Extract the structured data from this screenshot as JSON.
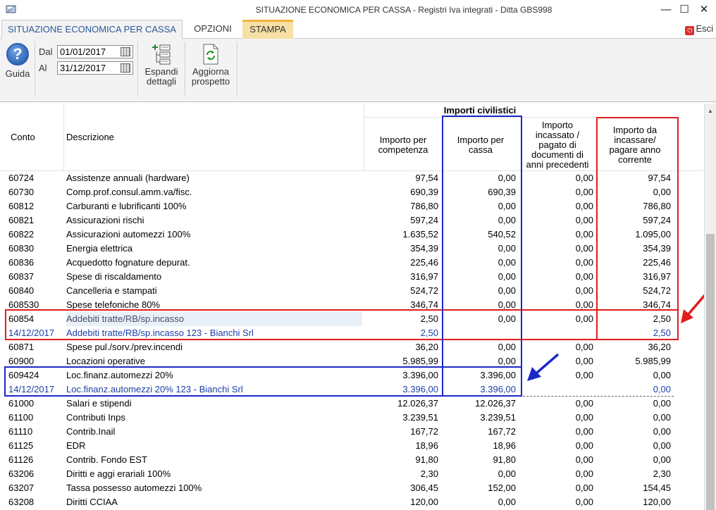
{
  "window": {
    "title": "SITUAZIONE ECONOMICA PER CASSA - Registri Iva integrati - Ditta GBS998",
    "minimize": "—",
    "maximize": "☐",
    "close": "✕"
  },
  "tabs": [
    {
      "label": "SITUAZIONE ECONOMICA PER CASSA"
    },
    {
      "label": "OPZIONI"
    },
    {
      "label": "STAMPA"
    }
  ],
  "esci_label": "Esci",
  "ribbon": {
    "guida_label": "Guida",
    "dal_label": "Dal",
    "dal_value": "01/01/2017",
    "al_label": "Al",
    "al_value": "31/12/2017",
    "espandi_line1": "Espandi",
    "espandi_line2": "dettagli",
    "aggiorna_line1": "Aggiorna",
    "aggiorna_line2": "prospetto"
  },
  "table": {
    "group_header": "Importi civilistici",
    "col_conto": "Conto",
    "col_desc": "Descrizione",
    "col_competenza": [
      "Importo per",
      "competenza"
    ],
    "col_cassa": [
      "Importo per",
      "cassa"
    ],
    "col_incassato": [
      "Importo",
      "incassato /",
      "pagato di",
      "documenti di",
      "anni precedenti"
    ],
    "col_incassare": [
      "Importo da",
      "incassare/",
      "pagare anno",
      "corrente"
    ],
    "rows": [
      {
        "conto": "60724",
        "desc": "Assistenze annuali (hardware)",
        "v1": "97,54",
        "v2": "0,00",
        "v3": "0,00",
        "v4": "97,54"
      },
      {
        "conto": "60730",
        "desc": "Comp.prof.consul.amm.va/fisc.",
        "v1": "690,39",
        "v2": "690,39",
        "v3": "0,00",
        "v4": "0,00"
      },
      {
        "conto": "60812",
        "desc": "Carburanti e lubrificanti 100%",
        "v1": "786,80",
        "v2": "0,00",
        "v3": "0,00",
        "v4": "786,80"
      },
      {
        "conto": "60821",
        "desc": "Assicurazioni rischi",
        "v1": "597,24",
        "v2": "0,00",
        "v3": "0,00",
        "v4": "597,24"
      },
      {
        "conto": "60822",
        "desc": "Assicurazioni automezzi 100%",
        "v1": "1.635,52",
        "v2": "540,52",
        "v3": "0,00",
        "v4": "1.095,00"
      },
      {
        "conto": "60830",
        "desc": "Energia elettrica",
        "v1": "354,39",
        "v2": "0,00",
        "v3": "0,00",
        "v4": "354,39"
      },
      {
        "conto": "60836",
        "desc": "Acquedotto fognature depurat.",
        "v1": "225,46",
        "v2": "0,00",
        "v3": "0,00",
        "v4": "225,46"
      },
      {
        "conto": "60837",
        "desc": "Spese di riscaldamento",
        "v1": "316,97",
        "v2": "0,00",
        "v3": "0,00",
        "v4": "316,97"
      },
      {
        "conto": "60840",
        "desc": "Cancelleria e stampati",
        "v1": "524,72",
        "v2": "0,00",
        "v3": "0,00",
        "v4": "524,72"
      },
      {
        "conto": "608530",
        "desc": "Spese telefoniche 80%",
        "v1": "346,74",
        "v2": "0,00",
        "v3": "0,00",
        "v4": "346,74"
      },
      {
        "conto": "60854",
        "desc": "Addebiti tratte/RB/sp.incasso",
        "v1": "2,50",
        "v2": "0,00",
        "v3": "0,00",
        "v4": "2,50",
        "style": "grey"
      },
      {
        "conto": "14/12/2017",
        "desc": "Addebiti tratte/RB/sp.incasso 123 -  Bianchi Srl",
        "v1": "2,50",
        "v2": "",
        "v3": "",
        "v4": "2,50",
        "style": "detail"
      },
      {
        "conto": "60871",
        "desc": "Spese pul./sorv./prev.incendi",
        "v1": "36,20",
        "v2": "0,00",
        "v3": "0,00",
        "v4": "36,20"
      },
      {
        "conto": "60900",
        "desc": "Locazioni operative",
        "v1": "5.985,99",
        "v2": "0,00",
        "v3": "0,00",
        "v4": "5.985,99"
      },
      {
        "conto": "609424",
        "desc": "Loc.finanz.automezzi 20%",
        "v1": "3.396,00",
        "v2": "3.396,00",
        "v3": "0,00",
        "v4": "0,00"
      },
      {
        "conto": "14/12/2017",
        "desc": "Loc.finanz.automezzi 20% 123 -  Bianchi Srl",
        "v1": "3.396,00",
        "v2": "3.396,00",
        "v3": "",
        "v4": "0,00",
        "style": "detail"
      },
      {
        "conto": "61000",
        "desc": "Salari e stipendi",
        "v1": "12.026,37",
        "v2": "12.026,37",
        "v3": "0,00",
        "v4": "0,00"
      },
      {
        "conto": "61100",
        "desc": "Contributi Inps",
        "v1": "3.239,51",
        "v2": "3.239,51",
        "v3": "0,00",
        "v4": "0,00"
      },
      {
        "conto": "61110",
        "desc": "Contrib.Inail",
        "v1": "167,72",
        "v2": "167,72",
        "v3": "0,00",
        "v4": "0,00"
      },
      {
        "conto": "61125",
        "desc": "EDR",
        "v1": "18,96",
        "v2": "18,96",
        "v3": "0,00",
        "v4": "0,00"
      },
      {
        "conto": "61126",
        "desc": "Contrib. Fondo EST",
        "v1": "91,80",
        "v2": "91,80",
        "v3": "0,00",
        "v4": "0,00"
      },
      {
        "conto": "63206",
        "desc": "Diritti e aggi erariali 100%",
        "v1": "2,30",
        "v2": "0,00",
        "v3": "0,00",
        "v4": "2,30"
      },
      {
        "conto": "63207",
        "desc": "Tassa possesso automezzi 100%",
        "v1": "306,45",
        "v2": "152,00",
        "v3": "0,00",
        "v4": "154,45"
      },
      {
        "conto": "63208",
        "desc": "Diritti CCIAA",
        "v1": "120,00",
        "v2": "0,00",
        "v3": "0,00",
        "v4": "120,00"
      }
    ]
  },
  "colors": {
    "highlight_red": "#e11d1d",
    "highlight_blue": "#1d28c9",
    "detail_text": "#1a3fa8",
    "accent_tab": "#2a579a",
    "stampa_tab": "#f7e0a6"
  }
}
